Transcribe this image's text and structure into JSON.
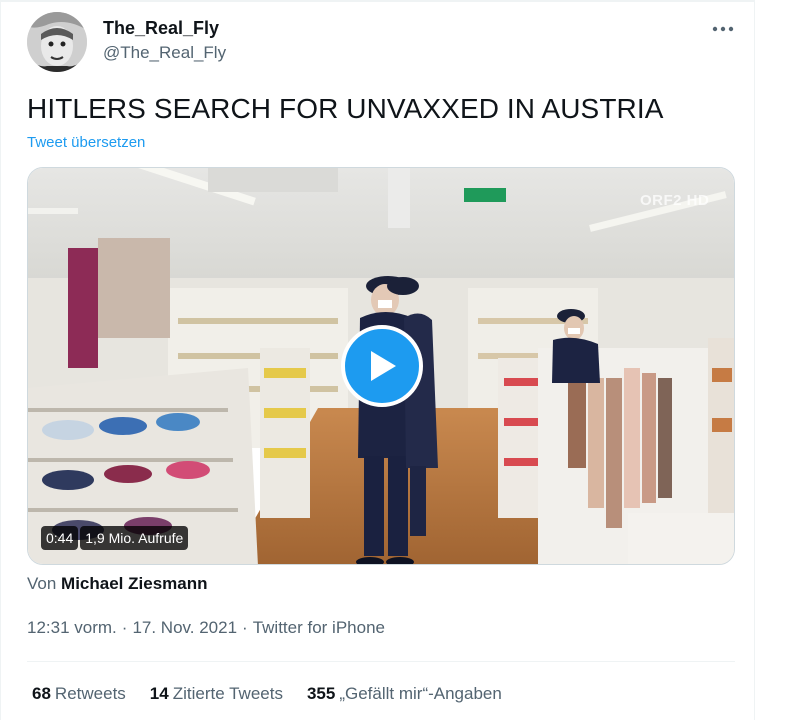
{
  "author": {
    "display_name": "The_Real_Fly",
    "handle": "@The_Real_Fly",
    "avatar_icon": "user-avatar-photo"
  },
  "tweet": {
    "text": "HITLERS SEARCH FOR UNVAXXED IN AUSTRIA",
    "translate_label": "Tweet übersetzen"
  },
  "media": {
    "duration": "0:44",
    "views": "1,9 Mio. Aufrufe",
    "broadcaster_logo": "ORF2 HD",
    "play_icon": "play-icon"
  },
  "source": {
    "prefix": "Von",
    "author": "Michael Ziesmann"
  },
  "meta": {
    "time": "12:31 vorm.",
    "separator": "·",
    "date": "17. Nov. 2021",
    "client": "Twitter for iPhone"
  },
  "stats": {
    "retweets_count": "68",
    "retweets_label": "Retweets",
    "quotes_count": "14",
    "quotes_label": "Zitierte Tweets",
    "likes_count": "355",
    "likes_label": "„Gefällt mir“-Angaben"
  },
  "colors": {
    "accent": "#1d9bf0",
    "secondary_text": "#536471",
    "primary_text": "#0f1419"
  }
}
